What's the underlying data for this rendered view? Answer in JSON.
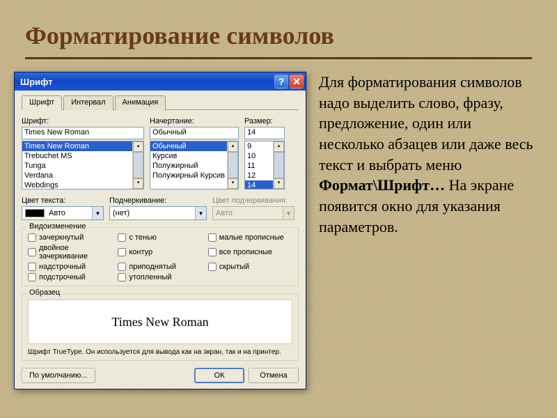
{
  "slide": {
    "title": "Форматирование символов",
    "body_1": "Для форматирования символов надо выделить слово, фразу, предложение, один или несколько абзацев или даже весь текст и выбрать меню ",
    "body_bold": "Формат\\Шрифт…",
    "body_2": " На экране появится окно для указания параметров."
  },
  "dialog": {
    "title": "Шрифт",
    "tabs": [
      "Шрифт",
      "Интервал",
      "Анимация"
    ],
    "font": {
      "label": "Шрифт:",
      "value": "Times New Roman",
      "options": [
        "Times New Roman",
        "Trebuchet MS",
        "Tunga",
        "Verdana",
        "Webdings"
      ],
      "selected": "Times New Roman"
    },
    "style": {
      "label": "Начертание:",
      "value": "Обычный",
      "options": [
        "Обычный",
        "Курсив",
        "Полужирный",
        "Полужирный Курсив"
      ],
      "selected": "Обычный"
    },
    "size": {
      "label": "Размер:",
      "value": "14",
      "options": [
        "9",
        "10",
        "11",
        "12",
        "14"
      ],
      "selected": "14"
    },
    "text_color": {
      "label": "Цвет текста:",
      "value": "Авто"
    },
    "underline": {
      "label": "Подчеркивание:",
      "value": "(нет)"
    },
    "underline_color": {
      "label": "Цвет подчеркивания:",
      "value": "Авто"
    },
    "effects_legend": "Видоизменение",
    "effects": {
      "col1": [
        "зачеркнутый",
        "двойное зачеркивание",
        "надстрочный",
        "подстрочный"
      ],
      "col2": [
        "с тенью",
        "контур",
        "приподнятый",
        "утопленный"
      ],
      "col3": [
        "малые прописные",
        "все прописные",
        "скрытый"
      ]
    },
    "preview_legend": "Образец",
    "preview_text": "Times New Roman",
    "truetype": "Шрифт TrueType. Он используется для вывода как на экран, так и на принтер.",
    "buttons": {
      "default": "По умолчанию...",
      "ok": "ОК",
      "cancel": "Отмена"
    }
  }
}
